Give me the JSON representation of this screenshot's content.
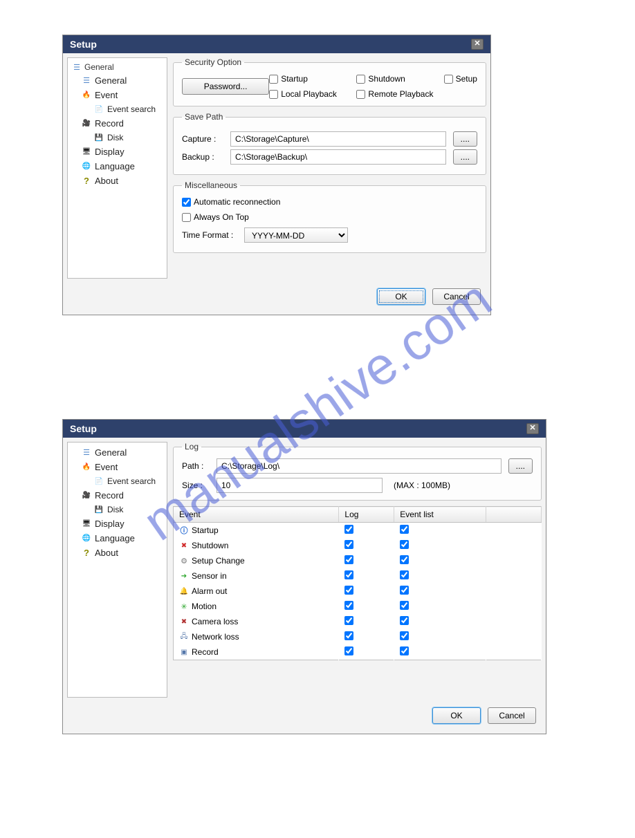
{
  "dialog_title": "Setup",
  "nav": {
    "top_clip": "General",
    "general": "General",
    "event": "Event",
    "event_search": "Event search",
    "record": "Record",
    "disk": "Disk",
    "display": "Display",
    "language": "Language",
    "about": "About"
  },
  "security": {
    "legend": "Security Option",
    "startup": "Startup",
    "shutdown": "Shutdown",
    "setup": "Setup",
    "local_playback": "Local Playback",
    "remote_playback": "Remote Playback",
    "password_btn": "Password..."
  },
  "savepath": {
    "legend": "Save Path",
    "capture_label": "Capture :",
    "capture_value": "C:\\Storage\\Capture\\",
    "backup_label": "Backup :",
    "backup_value": "C:\\Storage\\Backup\\",
    "browse": "...."
  },
  "misc": {
    "legend": "Miscellaneous",
    "auto_reconn": "Automatic reconnection",
    "always_on_top": "Always On Top",
    "time_format_label": "Time Format :",
    "time_format_value": "YYYY-MM-DD"
  },
  "log": {
    "legend": "Log",
    "path_label": "Path :",
    "path_value": "C:\\Storage\\Log\\",
    "size_label": "Size :",
    "size_value": "10",
    "max_label": "(MAX : 100MB)",
    "browse": "...."
  },
  "table": {
    "col_event": "Event",
    "col_log": "Log",
    "col_list": "Event list",
    "rows": [
      {
        "name": "Startup",
        "icon": "ico-i"
      },
      {
        "name": "Shutdown",
        "icon": "ico-x"
      },
      {
        "name": "Setup Change",
        "icon": "ico-gear"
      },
      {
        "name": "Sensor in",
        "icon": "ico-sensor"
      },
      {
        "name": "Alarm out",
        "icon": "ico-alarm"
      },
      {
        "name": "Motion",
        "icon": "ico-motion"
      },
      {
        "name": "Camera loss",
        "icon": "ico-camloss"
      },
      {
        "name": "Network loss",
        "icon": "ico-netloss"
      },
      {
        "name": "Record",
        "icon": "ico-rec"
      }
    ]
  },
  "buttons": {
    "ok": "OK",
    "cancel": "Cancel"
  },
  "watermark": "manualshive.com"
}
